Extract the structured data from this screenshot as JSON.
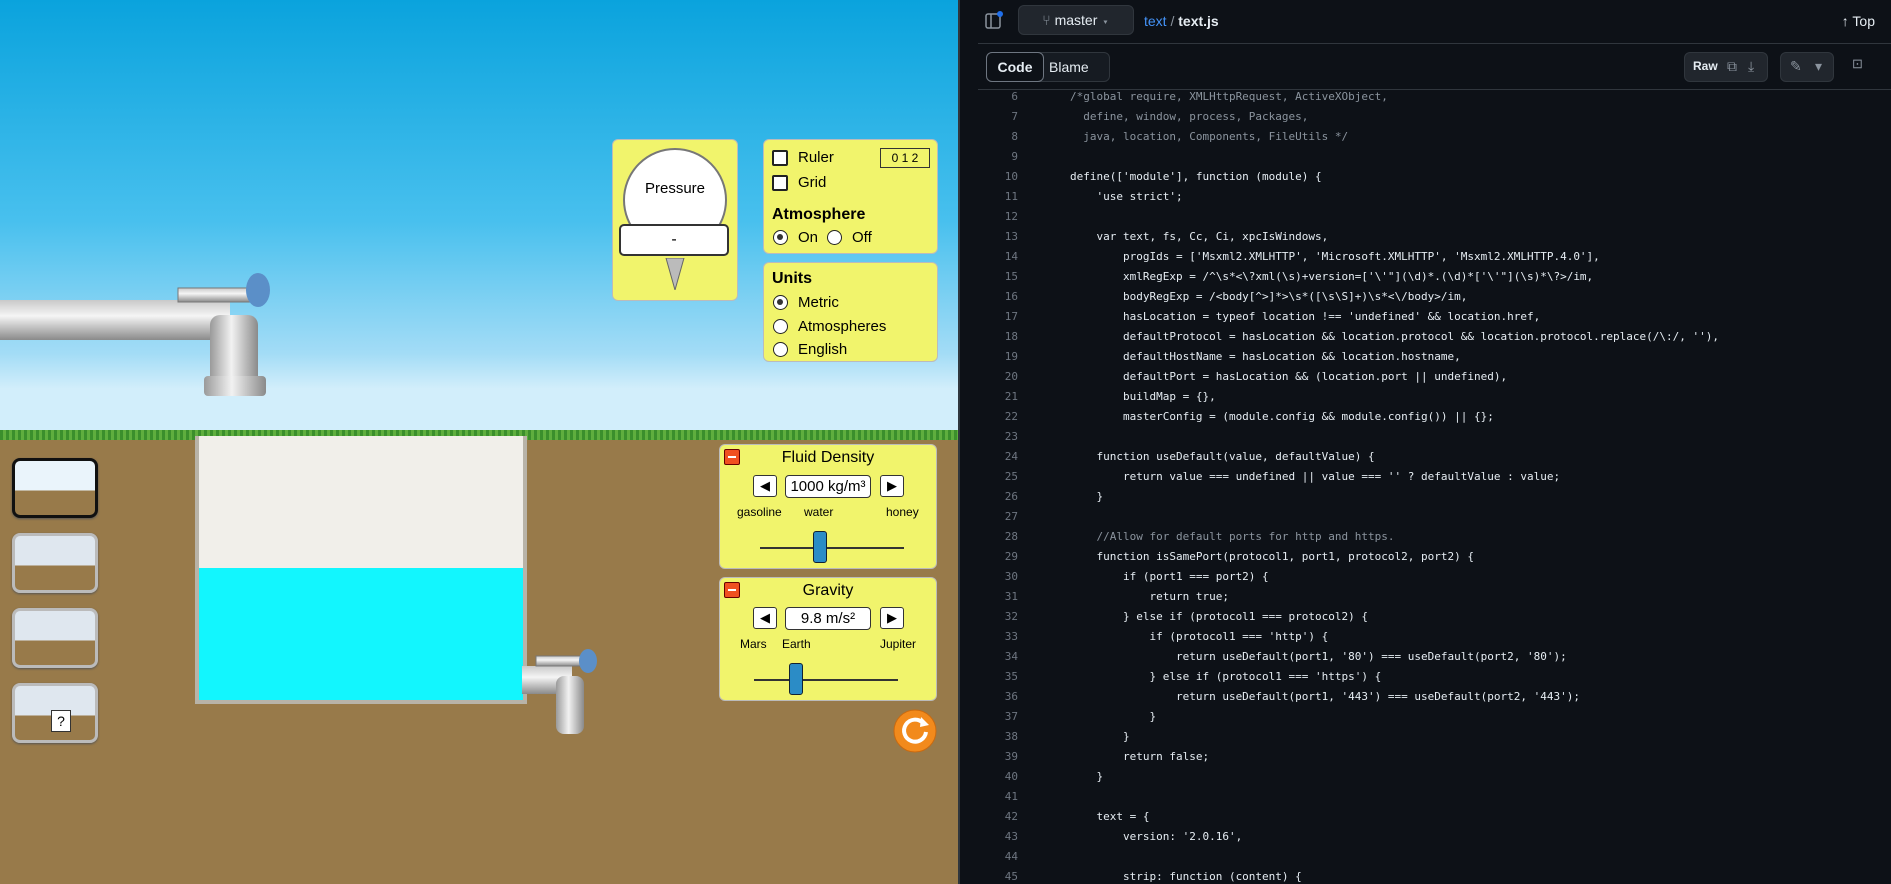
{
  "sim": {
    "pressure_label": "Pressure",
    "pressure_value": "-",
    "ruler": "Ruler",
    "ruler_scale": "0 1 2",
    "grid": "Grid",
    "atmosphere": "Atmosphere",
    "atm_on": "On",
    "atm_off": "Off",
    "units": "Units",
    "u_metric": "Metric",
    "u_atm": "Atmospheres",
    "u_eng": "English",
    "density_title": "Fluid Density",
    "density_value": "1000 kg/m³",
    "density_ticks": [
      "gasoline",
      "water",
      "honey"
    ],
    "density_level": 0.42,
    "gravity_title": "Gravity",
    "gravity_value": "9.8 m/s²",
    "gravity_ticks": [
      "Mars",
      "Earth",
      "Jupiter"
    ],
    "gravity_level": 0.29,
    "mystery_label": "?",
    "colors": {
      "water": "#12f6fe",
      "panel": "#f1f46c",
      "ground": "#987a4a"
    }
  },
  "github": {
    "branch": "master",
    "path_dir": "text",
    "path_sep": "/",
    "path_file": "text.js",
    "top": "Top",
    "tab_code": "Code",
    "tab_blame": "Blame",
    "raw": "Raw",
    "lines": [
      {
        "n": "6",
        "t": "/*global require, XMLHttpRequest, ActiveXObject,"
      },
      {
        "n": "7",
        "t": "  define, window, process, Packages,"
      },
      {
        "n": "8",
        "t": "  java, location, Components, FileUtils */"
      },
      {
        "n": "9",
        "t": ""
      },
      {
        "n": "10",
        "t": "define(['module'], function (module) {"
      },
      {
        "n": "11",
        "t": "    'use strict';"
      },
      {
        "n": "12",
        "t": ""
      },
      {
        "n": "13",
        "t": "    var text, fs, Cc, Ci, xpcIsWindows,"
      },
      {
        "n": "14",
        "t": "        progIds = ['Msxml2.XMLHTTP', 'Microsoft.XMLHTTP', 'Msxml2.XMLHTTP.4.0'],"
      },
      {
        "n": "15",
        "t": "        xmlRegExp = /^\\s*<\\?xml(\\s)+version=['\\'\"](\\d)*.(\\d)*['\\'\"](\\s)*\\?>/im,"
      },
      {
        "n": "16",
        "t": "        bodyRegExp = /<body[^>]*>\\s*([\\s\\S]+)\\s*<\\/body>/im,"
      },
      {
        "n": "17",
        "t": "        hasLocation = typeof location !== 'undefined' && location.href,"
      },
      {
        "n": "18",
        "t": "        defaultProtocol = hasLocation && location.protocol && location.protocol.replace(/\\:/, ''),"
      },
      {
        "n": "19",
        "t": "        defaultHostName = hasLocation && location.hostname,"
      },
      {
        "n": "20",
        "t": "        defaultPort = hasLocation && (location.port || undefined),"
      },
      {
        "n": "21",
        "t": "        buildMap = {},"
      },
      {
        "n": "22",
        "t": "        masterConfig = (module.config && module.config()) || {};"
      },
      {
        "n": "23",
        "t": ""
      },
      {
        "n": "24",
        "t": "    function useDefault(value, defaultValue) {"
      },
      {
        "n": "25",
        "t": "        return value === undefined || value === '' ? defaultValue : value;"
      },
      {
        "n": "26",
        "t": "    }"
      },
      {
        "n": "27",
        "t": ""
      },
      {
        "n": "28",
        "t": "    //Allow for default ports for http and https."
      },
      {
        "n": "29",
        "t": "    function isSamePort(protocol1, port1, protocol2, port2) {"
      },
      {
        "n": "30",
        "t": "        if (port1 === port2) {"
      },
      {
        "n": "31",
        "t": "            return true;"
      },
      {
        "n": "32",
        "t": "        } else if (protocol1 === protocol2) {"
      },
      {
        "n": "33",
        "t": "            if (protocol1 === 'http') {"
      },
      {
        "n": "34",
        "t": "                return useDefault(port1, '80') === useDefault(port2, '80');"
      },
      {
        "n": "35",
        "t": "            } else if (protocol1 === 'https') {"
      },
      {
        "n": "36",
        "t": "                return useDefault(port1, '443') === useDefault(port2, '443');"
      },
      {
        "n": "37",
        "t": "            }"
      },
      {
        "n": "38",
        "t": "        }"
      },
      {
        "n": "39",
        "t": "        return false;"
      },
      {
        "n": "40",
        "t": "    }"
      },
      {
        "n": "41",
        "t": ""
      },
      {
        "n": "42",
        "t": "    text = {"
      },
      {
        "n": "43",
        "t": "        version: '2.0.16',"
      },
      {
        "n": "44",
        "t": ""
      },
      {
        "n": "45",
        "t": "        strip: function (content) {"
      }
    ]
  }
}
